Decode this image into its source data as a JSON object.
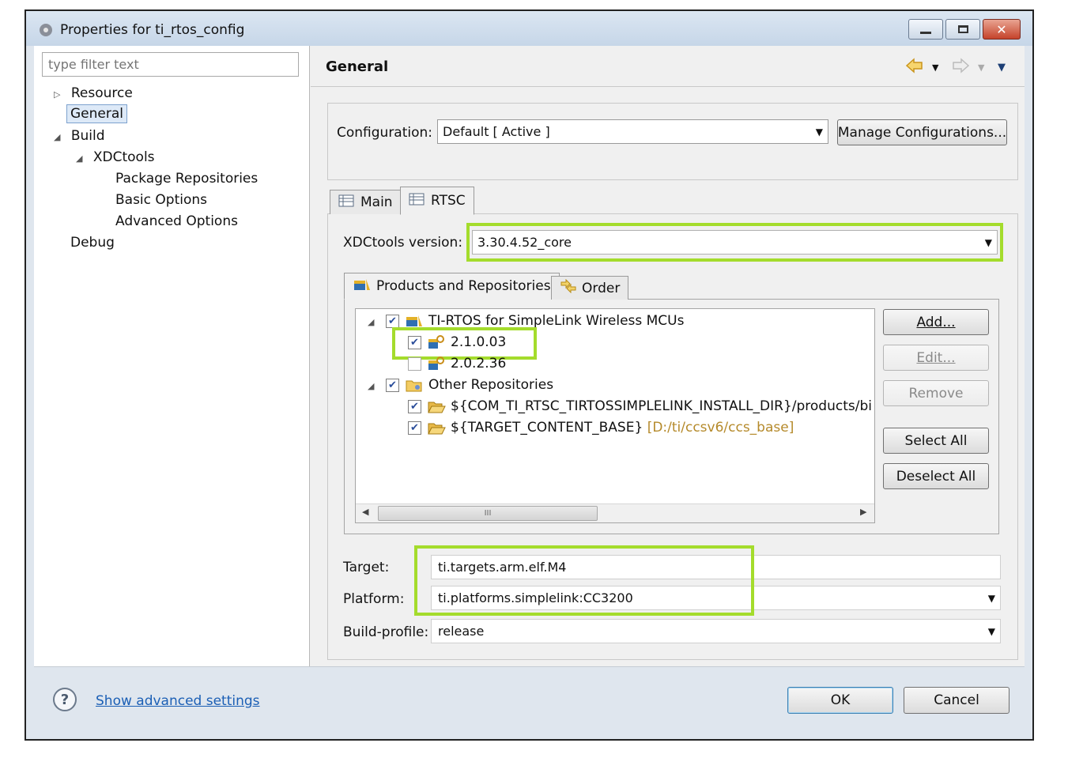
{
  "window": {
    "title": "Properties for ti_rtos_config"
  },
  "filter": {
    "placeholder": "type filter text"
  },
  "nav": {
    "resource": "Resource",
    "general": "General",
    "build": "Build",
    "xdctools": "XDCtools",
    "package_repositories": "Package Repositories",
    "basic_options": "Basic Options",
    "advanced_options": "Advanced Options",
    "debug": "Debug"
  },
  "page": {
    "title": "General"
  },
  "configuration": {
    "label": "Configuration:",
    "value": "Default  [ Active ]",
    "manage_button": "Manage Configurations..."
  },
  "tabs": {
    "main": "Main",
    "rtsc": "RTSC"
  },
  "xdctools": {
    "label": "XDCtools version:",
    "value": "3.30.4.52_core"
  },
  "subtabs": {
    "products": "Products and Repositories",
    "order": "Order"
  },
  "products_tree": {
    "tirtos": "TI-RTOS for SimpleLink Wireless MCUs",
    "v1": "2.1.0.03",
    "v2": "2.0.2.36",
    "other": "Other Repositories",
    "repo1": "${COM_TI_RTSC_TIRTOSSIMPLELINK_INSTALL_DIR}/products/bios_",
    "repo2_main": "${TARGET_CONTENT_BASE}",
    "repo2_path": "[D:/ti/ccsv6/ccs_base]",
    "scroll_grip": "III"
  },
  "side_buttons": {
    "add": "Add...",
    "edit": "Edit...",
    "remove": "Remove",
    "select_all": "Select All",
    "deselect_all": "Deselect All"
  },
  "target": {
    "label": "Target:",
    "value": "ti.targets.arm.elf.M4"
  },
  "platform": {
    "label": "Platform:",
    "value": "ti.platforms.simplelink:CC3200"
  },
  "build_profile": {
    "label": "Build-profile:",
    "value": "release"
  },
  "footer": {
    "advanced_link": "Show advanced settings",
    "ok": "OK",
    "cancel": "Cancel"
  },
  "colors": {
    "highlight": "#a4dc2c",
    "link": "#1b5fb5"
  },
  "icons": [
    "help-icon",
    "back-arrow-icon",
    "forward-arrow-icon",
    "menu-down-icon",
    "checkbox-icon",
    "package-icon",
    "folder-icon"
  ]
}
